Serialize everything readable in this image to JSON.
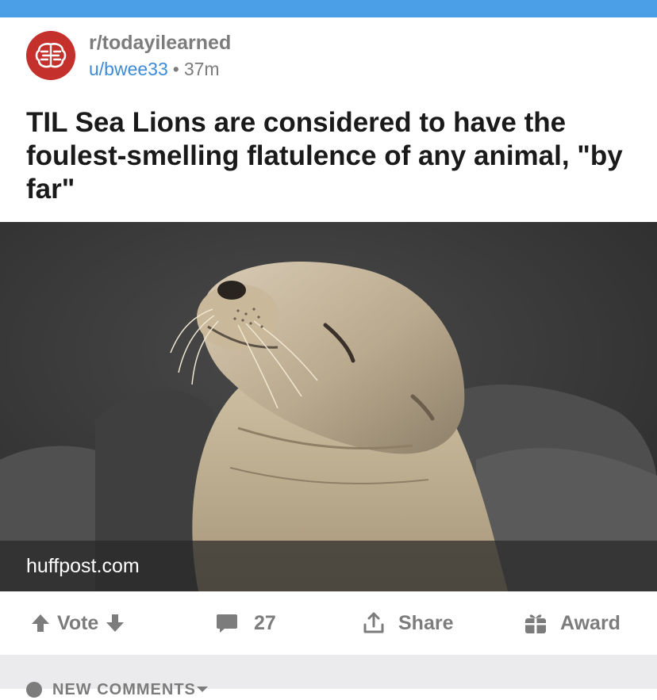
{
  "app": {
    "accent_color": "#4a9fe6",
    "subreddit_icon_color": "#c4302b"
  },
  "post": {
    "subreddit": "r/todayilearned",
    "author": "u/bwee33",
    "separator": "•",
    "age": "37m",
    "title": "TIL Sea Lions are considered to have the foulest-smelling flatulence of any animal, \"by far\"",
    "link_domain": "huffpost.com",
    "image_subject": "sea-lion-photo"
  },
  "actions": {
    "vote_label": "Vote",
    "comment_count": "27",
    "share_label": "Share",
    "award_label": "Award",
    "icons": [
      "arrow-up-icon",
      "arrow-down-icon",
      "comment-icon",
      "share-icon",
      "award-icon"
    ]
  },
  "comments_section": {
    "sort_label": "NEW COMMENTS",
    "icons": [
      "sort-icon",
      "chevron-down-icon"
    ]
  }
}
